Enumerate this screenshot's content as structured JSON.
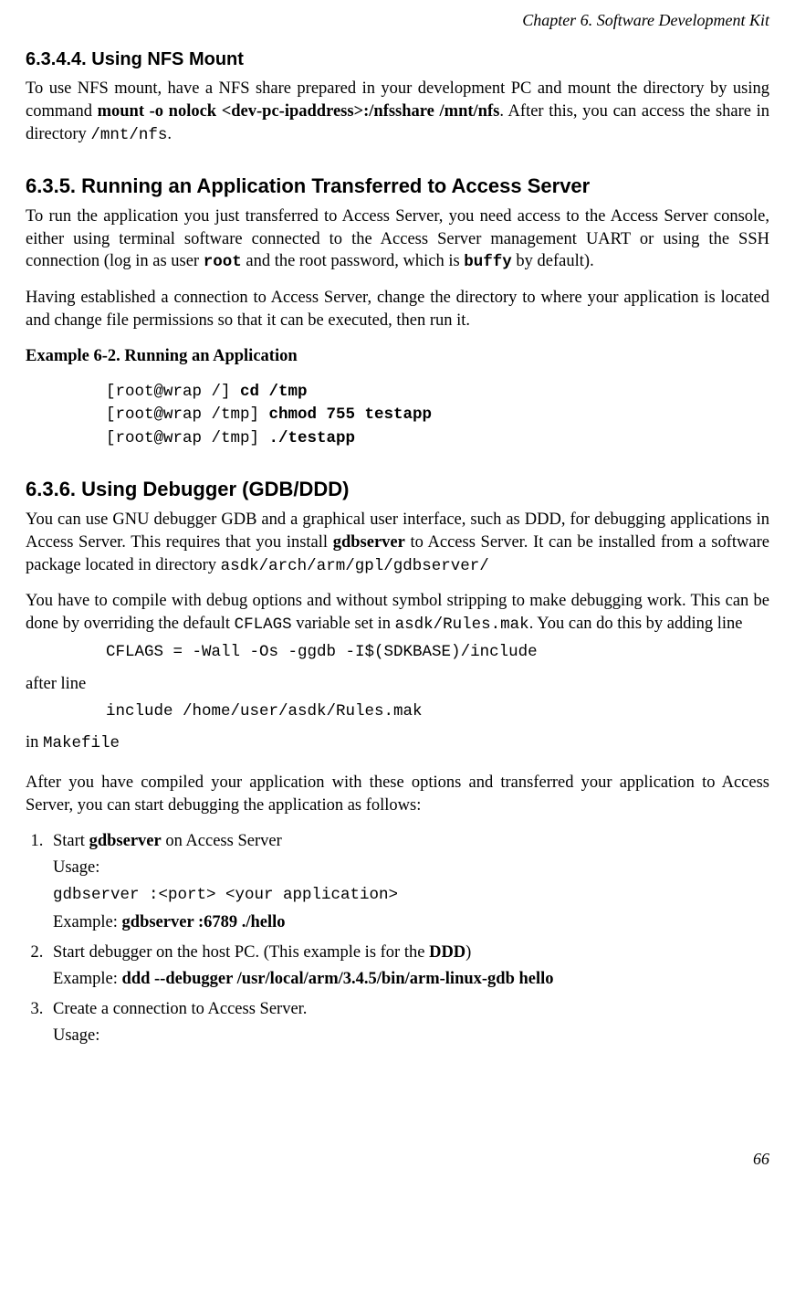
{
  "header": {
    "running": "Chapter 6. Software Development Kit"
  },
  "s1": {
    "heading": "6.3.4.4. Using NFS Mount",
    "p1_a": "To use NFS mount, have a NFS share prepared in your development PC and mount the directory by using command ",
    "p1_b": "mount -o nolock <dev-pc-ipaddress>:/nfsshare /mnt/nfs",
    "p1_c": ". After this, you can access the share in directory ",
    "p1_d": "/mnt/nfs",
    "p1_e": "."
  },
  "s2": {
    "heading": "6.3.5. Running an Application Transferred to Access Server",
    "p1_a": "To run the application you just transferred to Access Server, you need access to the Access Server console, either using terminal software connected to the Access Server management UART or using the SSH connection (log in as user ",
    "p1_b": "root",
    "p1_c": " and the root password, which is ",
    "p1_d": "buffy",
    "p1_e": " by default).",
    "p2": "Having established a connection to Access Server, change the directory to where your application is located and change file permissions so that it can be executed, then run it.",
    "example_title": "Example 6-2. Running an Application",
    "code": {
      "l1a": "[root@wrap /] ",
      "l1b": "cd /tmp",
      "l2a": "[root@wrap /tmp] ",
      "l2b": "chmod 755 testapp",
      "l3a": "[root@wrap /tmp] ",
      "l3b": "./testapp"
    }
  },
  "s3": {
    "heading": "6.3.6. Using Debugger (GDB/DDD)",
    "p1_a": "You can use GNU debugger GDB and a graphical user interface, such as DDD, for debugging applications in Access Server. This requires that you install ",
    "p1_b": "gdbserver",
    "p1_c": " to Access Server. It can be installed from a software package located in directory ",
    "p1_d": "asdk/arch/arm/gpl/gdbserver/",
    "p2_a": "You have to compile with debug options and without symbol stripping to make debugging work. This can be done by overriding the default ",
    "p2_b": "CFLAGS",
    "p2_c": " variable set in ",
    "p2_d": "asdk/Rules.mak",
    "p2_e": ". You can do this by adding line",
    "code1": "CFLAGS = -Wall -Os -ggdb -I$(SDKBASE)/include",
    "after_line": "after line",
    "code2": "include /home/user/asdk/Rules.mak",
    "in_a": "in ",
    "in_b": "Makefile",
    "p3": "After you have compiled your application with these options and transferred your application to Access Server, you can start debugging the application as follows:",
    "steps": {
      "s1": {
        "t1_a": "Start ",
        "t1_b": "gdbserver",
        "t1_c": " on Access Server",
        "usage": "Usage:",
        "code": "gdbserver :<port> <your application>",
        "ex_a": "Example: ",
        "ex_b": "gdbserver :6789 ./hello"
      },
      "s2": {
        "t1_a": "Start debugger on the host PC. (This example is for the ",
        "t1_b": "DDD",
        "t1_c": ")",
        "ex_a": "Example: ",
        "ex_b": "ddd --debugger /usr/local/arm/3.4.5/bin/arm-linux-gdb hello"
      },
      "s3": {
        "t1": "Create a connection to Access Server.",
        "usage": "Usage:"
      }
    }
  },
  "page_number": "66"
}
